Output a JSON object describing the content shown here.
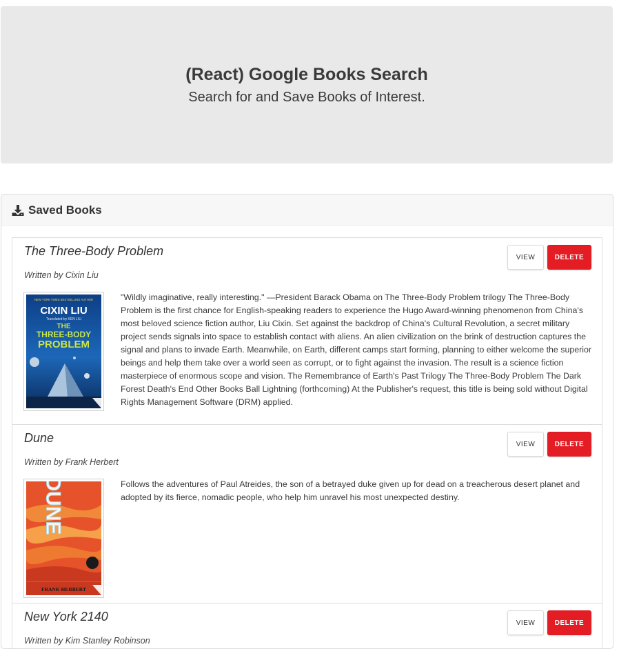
{
  "header": {
    "title": "(React) Google Books Search",
    "subtitle": "Search for and Save Books of Interest."
  },
  "saved": {
    "heading": "Saved Books",
    "icon": "download-icon",
    "view_label": "VIEW",
    "delete_label": "DELETE",
    "books": [
      {
        "title": "The Three-Body Problem",
        "author": "Written by Cixin Liu",
        "description": "\"Wildly imaginative, really interesting.\" —President Barack Obama on The Three-Body Problem trilogy The Three-Body Problem is the first chance for English-speaking readers to experience the Hugo Award-winning phenomenon from China's most beloved science fiction author, Liu Cixin. Set against the backdrop of China's Cultural Revolution, a secret military project sends signals into space to establish contact with aliens. An alien civilization on the brink of destruction captures the signal and plans to invade Earth. Meanwhile, on Earth, different camps start forming, planning to either welcome the superior beings and help them take over a world seen as corrupt, or to fight against the invasion. The result is a science fiction masterpiece of enormous scope and vision. The Remembrance of Earth's Past Trilogy The Three-Body Problem The Dark Forest Death's End Other Books Ball Lightning (forthcoming) At the Publisher's request, this title is being sold without Digital Rights Management Software (DRM) applied.",
        "cover": {
          "tagline": "NEW YORK TIMES BESTSELLING AUTHOR",
          "author_name": "CIXIN LIU",
          "translator": "Translated by KEN LIU",
          "line1": "THE",
          "line2": "THREE-BODY",
          "line3": "PROBLEM"
        }
      },
      {
        "title": "Dune",
        "author": "Written by Frank Herbert",
        "description": "Follows the adventures of Paul Atreides, the son of a betrayed duke given up for dead on a treacherous desert planet and adopted by its fierce, nomadic people, who help him unravel his most unexpected destiny.",
        "cover": {
          "title_text": "DUNE",
          "author_name": "FRANK HERBERT"
        }
      },
      {
        "title": "New York 2140",
        "author": "Written by Kim Stanley Robinson"
      }
    ]
  },
  "colors": {
    "jumbotron_bg": "#e9e9e9",
    "delete_red": "#e41c24"
  }
}
